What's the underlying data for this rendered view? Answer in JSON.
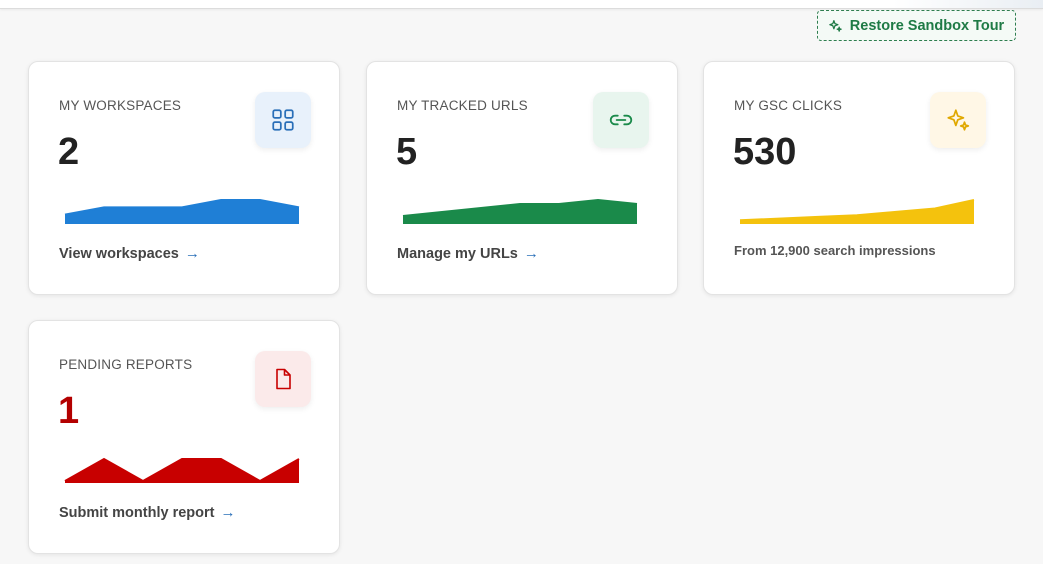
{
  "header": {
    "tour_button_label": "Restore Sandbox Tour"
  },
  "cards": [
    {
      "title": "MY WORKSPACES",
      "value": "2",
      "icon": "grid-icon",
      "link_label": "View workspaces",
      "color": "#1f7fd6",
      "icon_bg": "#e8f1fb",
      "sparkline": [
        3,
        6,
        6,
        6,
        9,
        9,
        6
      ]
    },
    {
      "title": "MY TRACKED URLS",
      "value": "5",
      "icon": "link-icon",
      "link_label": "Manage my URLs",
      "color": "#1a8a4a",
      "icon_bg": "#e8f5ee",
      "sparkline": [
        3,
        5,
        7,
        9,
        9,
        11,
        9
      ]
    },
    {
      "title": "MY GSC CLICKS",
      "value": "530",
      "icon": "sparkle-icon",
      "note": "From 12,900 search impressions",
      "color": "#f4c20d",
      "icon_bg": "#fff7e6",
      "sparkline": [
        1,
        2,
        3,
        4,
        6,
        8,
        13
      ]
    },
    {
      "title": "PENDING REPORTS",
      "value": "1",
      "icon": "document-icon",
      "link_label": "Submit monthly report",
      "color": "#c80000",
      "icon_bg": "#fbeaea",
      "sparkline": [
        0,
        8,
        0,
        8,
        8,
        0,
        8
      ]
    }
  ]
}
